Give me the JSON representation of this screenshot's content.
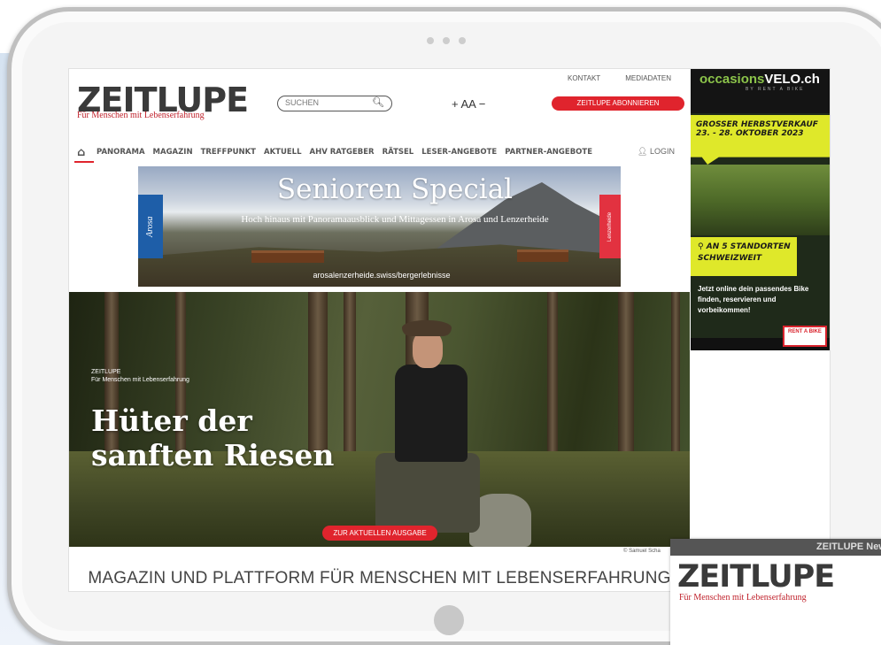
{
  "site": {
    "logo": "ZEITLUPE",
    "logo_sub": "Für Menschen mit Lebenserfahrung"
  },
  "header": {
    "search_placeholder": "SUCHEN",
    "font_size_control": "+ AA −",
    "top_links": [
      "KONTAKT",
      "MEDIADATEN"
    ],
    "subscribe_label": "ZEITLUPE ABONNIEREN",
    "login_label": "LOGIN"
  },
  "nav": {
    "items": [
      "PANORAMA",
      "MAGAZIN",
      "TREFFPUNKT",
      "AKTUELL",
      "AHV RATGEBER",
      "RÄTSEL",
      "LESER-ANGEBOTE",
      "PARTNER-ANGEBOTE"
    ]
  },
  "banner": {
    "title": "Senioren Special",
    "subtitle": "Hoch hinaus mit Panoramaausblick und Mittagessen in Arosa und Lenzerheide",
    "url": "arosalenzerheide.swiss/bergerlebnisse",
    "left_badge": "Arosa",
    "right_badge": "Lenzerheide"
  },
  "hero": {
    "kicker": "ZEITLUPE",
    "kicker_sub": "Für Menschen mit Lebenserfahrung",
    "title": "Hüter der sanften Riesen",
    "button": "ZUR AKTUELLEN AUSGABE",
    "credit": "© Samuel Scha"
  },
  "tagline": "MAGAZIN UND PLATTFORM FÜR MENSCHEN MIT LEBENSERFAHRUNG",
  "ad": {
    "brand_main": "occasions",
    "brand_accent": "VELO.ch",
    "slogan": "BY RENT A BIKE",
    "headline": "GROSSER HERBSTVERKAUF 23. - 28. OKTOBER 2023",
    "locations": "AN 5 STANDORTEN SCHWEIZWEIT",
    "body": "Jetzt online dein passendes Bike finden, reservieren und vorbeikommen!",
    "badge": "RENT A BIKE"
  },
  "newsletter": {
    "bar_brand": "ZEITLUPE",
    "bar_label": "News",
    "logo": "ZEITLUPE",
    "logo_sub": "Für Menschen mit Lebenserfahrung"
  },
  "colors": {
    "accent": "#e0242d",
    "ad_yellow": "#dfe82a",
    "ad_green": "#8bc34a"
  }
}
